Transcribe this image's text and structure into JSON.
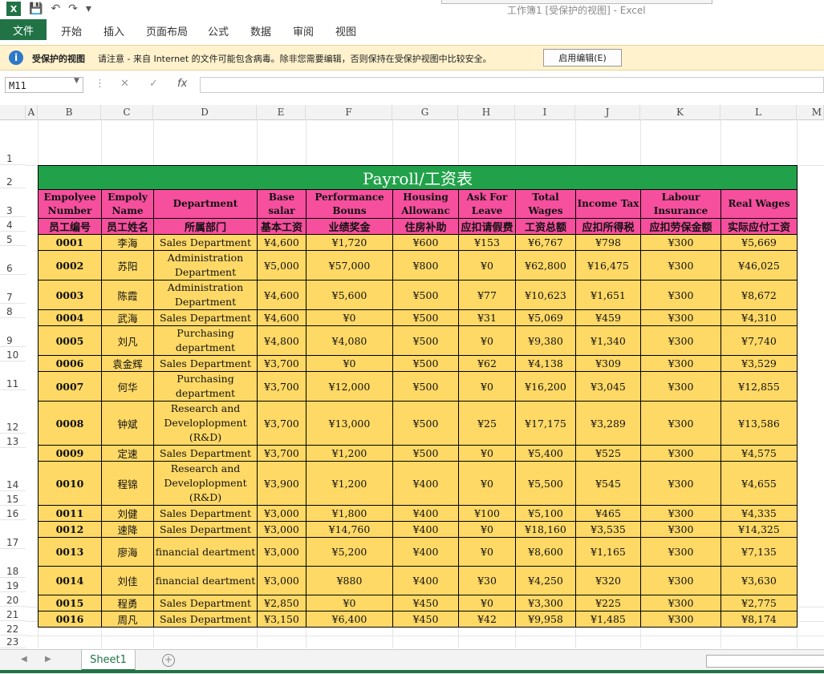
{
  "window": {
    "title": "工作簿1  [受保护的视图] - Excel"
  },
  "qat": {
    "save": "💾",
    "undo": "↶",
    "redo": "↷",
    "more": "▾"
  },
  "ribbon": {
    "file": "文件",
    "tabs": [
      "开始",
      "插入",
      "页面布局",
      "公式",
      "数据",
      "审阅",
      "视图"
    ]
  },
  "protected_bar": {
    "label": "受保护的视图",
    "message": "请注意 - 来自 Internet 的文件可能包含病毒。除非您需要编辑，否则保持在受保护视图中比较安全。",
    "button": "启用编辑(E)"
  },
  "formula_bar": {
    "name_box": "M11",
    "cancel": "✕",
    "enter": "✓",
    "fx": "fx",
    "value": ""
  },
  "columns": [
    "A",
    "B",
    "C",
    "D",
    "E",
    "F",
    "G",
    "H",
    "I",
    "J",
    "K",
    "L",
    "M"
  ],
  "rows": [
    "1",
    "2",
    "3",
    "4",
    "5",
    "6",
    "7",
    "8",
    "9",
    "10",
    "11",
    "12",
    "13",
    "14",
    "15",
    "16",
    "17",
    "18",
    "19",
    "20",
    "21",
    "22",
    "23"
  ],
  "sheet": {
    "title": "Payroll/工资表",
    "headers_en": [
      "Empolyee Number",
      "Empoly Name",
      "Department",
      "Base salar",
      "Performance Bouns",
      "Housing Allowanc",
      "Ask For Leave",
      "Total Wages",
      "Income Tax",
      "Labour Insurance",
      "Real Wages"
    ],
    "headers_cn": [
      "员工编号",
      "员工姓名",
      "所属部门",
      "基本工资",
      "业绩奖金",
      "住房补助",
      "应扣请假费",
      "工资总额",
      "应扣所得税",
      "应扣劳保金额",
      "实际应付工资"
    ],
    "records": [
      [
        "0001",
        "李海",
        "Sales Department",
        "¥4,600",
        "¥1,720",
        "¥600",
        "¥153",
        "¥6,767",
        "¥798",
        "¥300",
        "¥5,669"
      ],
      [
        "0002",
        "苏阳",
        "Administration Department",
        "¥5,000",
        "¥57,000",
        "¥800",
        "¥0",
        "¥62,800",
        "¥16,475",
        "¥300",
        "¥46,025"
      ],
      [
        "0003",
        "陈霞",
        "Administration Department",
        "¥4,600",
        "¥5,600",
        "¥500",
        "¥77",
        "¥10,623",
        "¥1,651",
        "¥300",
        "¥8,672"
      ],
      [
        "0004",
        "武海",
        "Sales Department",
        "¥4,600",
        "¥0",
        "¥500",
        "¥31",
        "¥5,069",
        "¥459",
        "¥300",
        "¥4,310"
      ],
      [
        "0005",
        "刘凡",
        "Purchasing department",
        "¥4,800",
        "¥4,080",
        "¥500",
        "¥0",
        "¥9,380",
        "¥1,340",
        "¥300",
        "¥7,740"
      ],
      [
        "0006",
        "袁金辉",
        "Sales Department",
        "¥3,700",
        "¥0",
        "¥500",
        "¥62",
        "¥4,138",
        "¥309",
        "¥300",
        "¥3,529"
      ],
      [
        "0007",
        "何华",
        "Purchasing department",
        "¥3,700",
        "¥12,000",
        "¥500",
        "¥0",
        "¥16,200",
        "¥3,045",
        "¥300",
        "¥12,855"
      ],
      [
        "0008",
        "钟斌",
        "Research and Developlopment (R&D)",
        "¥3,700",
        "¥13,000",
        "¥500",
        "¥25",
        "¥17,175",
        "¥3,289",
        "¥300",
        "¥13,586"
      ],
      [
        "0009",
        "定速",
        "Sales Department",
        "¥3,700",
        "¥1,200",
        "¥500",
        "¥0",
        "¥5,400",
        "¥525",
        "¥300",
        "¥4,575"
      ],
      [
        "0010",
        "程锦",
        "Research and Developlopment (R&D)",
        "¥3,900",
        "¥1,200",
        "¥400",
        "¥0",
        "¥5,500",
        "¥545",
        "¥300",
        "¥4,655"
      ],
      [
        "0011",
        "刘健",
        "Sales Department",
        "¥3,000",
        "¥1,800",
        "¥400",
        "¥100",
        "¥5,100",
        "¥465",
        "¥300",
        "¥4,335"
      ],
      [
        "0012",
        "速降",
        "Sales Department",
        "¥3,000",
        "¥14,760",
        "¥400",
        "¥0",
        "¥18,160",
        "¥3,535",
        "¥300",
        "¥14,325"
      ],
      [
        "0013",
        "廖海",
        "financial deartment",
        "¥3,000",
        "¥5,200",
        "¥400",
        "¥0",
        "¥8,600",
        "¥1,165",
        "¥300",
        "¥7,135"
      ],
      [
        "0014",
        "刘佳",
        "financial deartment",
        "¥3,000",
        "¥880",
        "¥400",
        "¥30",
        "¥4,250",
        "¥320",
        "¥300",
        "¥3,630"
      ],
      [
        "0015",
        "程勇",
        "Sales Department",
        "¥2,850",
        "¥0",
        "¥450",
        "¥0",
        "¥3,300",
        "¥225",
        "¥300",
        "¥2,775"
      ],
      [
        "0016",
        "周凡",
        "Sales Department",
        "¥3,150",
        "¥6,400",
        "¥450",
        "¥42",
        "¥9,958",
        "¥1,485",
        "¥300",
        "¥8,174"
      ]
    ]
  },
  "sheet_tabs": {
    "active": "Sheet1",
    "add": "+"
  },
  "colors": {
    "excel_green": "#217346",
    "title_fill": "#21a24a",
    "header_fill": "#f64f9e",
    "data_fill": "#ffd966",
    "protected_bar": "#fff2cc"
  }
}
